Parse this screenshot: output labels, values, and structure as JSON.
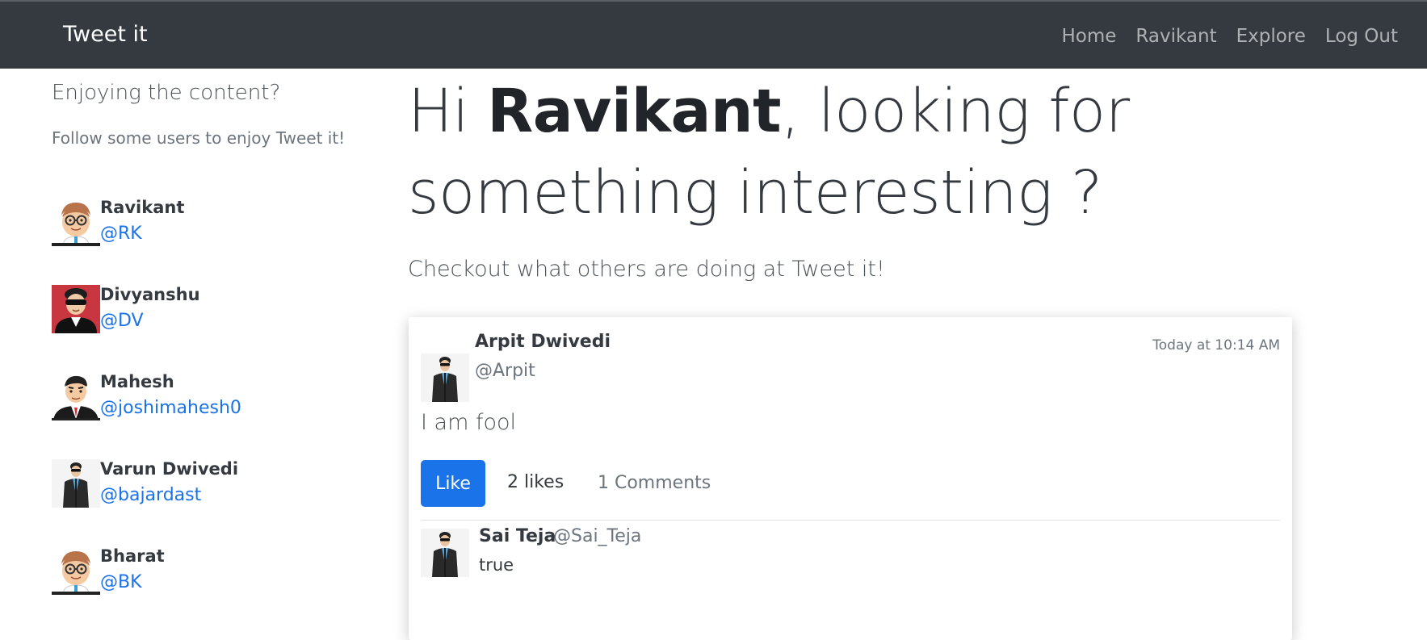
{
  "navbar": {
    "brand": "Tweet it",
    "links": [
      "Home",
      "Ravikant",
      "Explore",
      "Log Out"
    ]
  },
  "sidebar": {
    "title": "Enjoying the content?",
    "subtitle": "Follow some users to enjoy Tweet it!",
    "users": [
      {
        "name": "Ravikant",
        "handle": "@RK",
        "avatar": "cartoon-glasses-avatar"
      },
      {
        "name": "Divyanshu",
        "handle": "@DV",
        "avatar": "sunglasses-red-avatar"
      },
      {
        "name": "Mahesh",
        "handle": "@joshimahesh0",
        "avatar": "cartoon-suit-avatar"
      },
      {
        "name": "Varun Dwivedi",
        "handle": "@bajardast",
        "avatar": "jacket-sunglasses-avatar"
      },
      {
        "name": "Bharat",
        "handle": "@BK",
        "avatar": "cartoon-glasses-avatar"
      }
    ]
  },
  "main": {
    "headline": {
      "prefix": "Hi ",
      "name": "Ravikant",
      "suffix": ", looking for something interesting ?"
    },
    "lead": "Checkout what others are doing at Tweet it!"
  },
  "tweet": {
    "author": "Arpit Dwivedi",
    "handle": "@Arpit",
    "time": "Today at 10:14 AM",
    "body": "I am fool",
    "like_label": "Like",
    "likes": "2 likes",
    "comments": "1 Comments",
    "comment": {
      "author": "Sai Teja",
      "handle": "@Sai_Teja",
      "text": "true"
    }
  },
  "colors": {
    "navbar": "#343a40",
    "accent": "#1a73e8"
  }
}
